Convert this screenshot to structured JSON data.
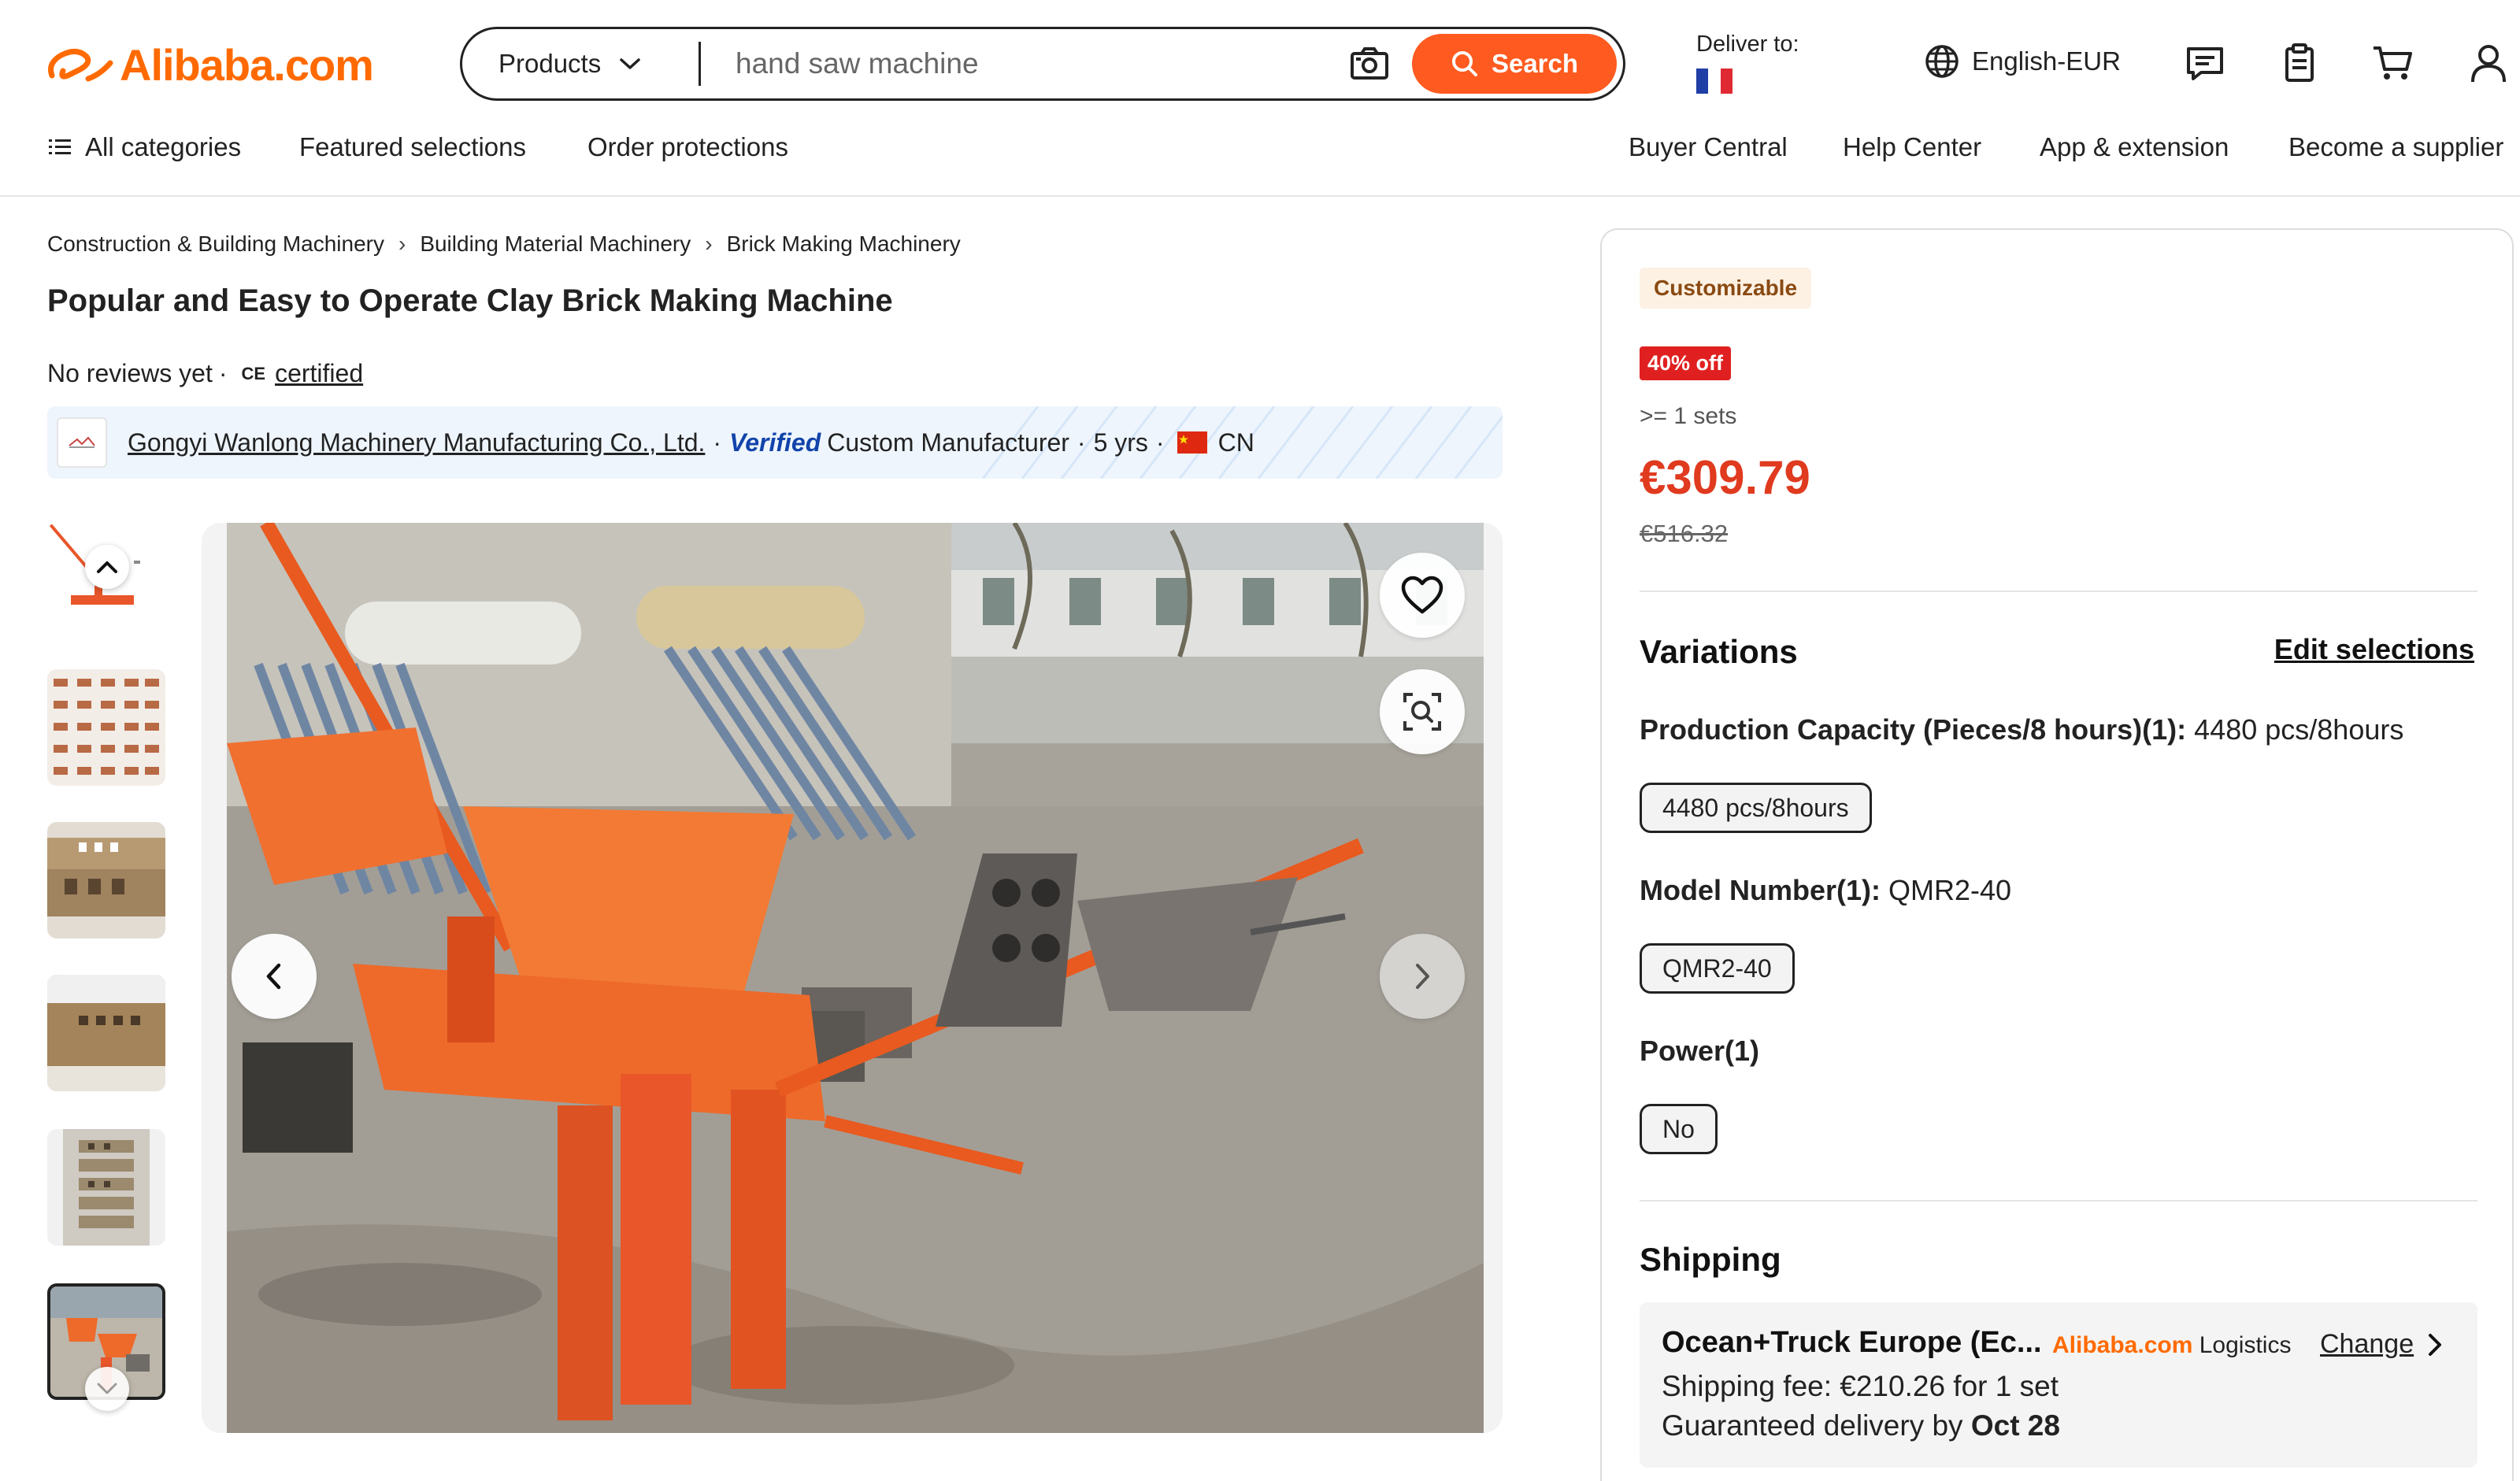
{
  "brand": {
    "logo_text": "Alibaba.com",
    "accent_color": "#ff6a00"
  },
  "search": {
    "category": "Products",
    "placeholder": "hand saw machine",
    "button_label": "Search"
  },
  "header": {
    "deliver_label": "Deliver to:",
    "deliver_country_flag": "FR",
    "language": "English-EUR",
    "icons": [
      "message-icon",
      "orders-icon",
      "cart-icon",
      "account-icon"
    ]
  },
  "subnav": {
    "all_categories": "All categories",
    "featured": "Featured selections",
    "order_protections": "Order protections",
    "buyer_central": "Buyer Central",
    "help_center": "Help Center",
    "app_extension": "App & extension",
    "become_supplier": "Become a supplier"
  },
  "breadcrumb": [
    "Construction & Building Machinery",
    "Building Material Machinery",
    "Brick Making Machinery"
  ],
  "product": {
    "title": "Popular and Easy to Operate Clay Brick Making Machine",
    "reviews": "No reviews yet",
    "separator": "·",
    "ce_mark": "CE",
    "certified": "certified"
  },
  "supplier": {
    "name": "Gongyi Wanlong Machinery Manufacturing Co., Ltd.",
    "sep": "·",
    "verified": "Verified",
    "type": "Custom Manufacturer",
    "years": "5 yrs",
    "country": "CN"
  },
  "thumbnails": {
    "count": 6,
    "active_index": 5
  },
  "offer": {
    "badge_customizable": "Customizable",
    "badge_discount": "40% off",
    "min_order": ">= 1 sets",
    "price": "€309.79",
    "old_price": "€516.32"
  },
  "variations": {
    "title": "Variations",
    "edit_label": "Edit selections",
    "capacity_label": "Production Capacity (Pieces/8 hours)(1):",
    "capacity_value": "4480 pcs/8hours",
    "capacity_option": "4480 pcs/8hours",
    "model_label": "Model Number(1):",
    "model_value": "QMR2-40",
    "model_option": "QMR2-40",
    "power_label": "Power(1)",
    "power_option": "No"
  },
  "shipping": {
    "title": "Shipping",
    "method": "Ocean+Truck Europe (Ec...",
    "logistics_brand": "Alibaba.com",
    "logistics_word": "Logistics",
    "change_label": "Change",
    "fee": "Shipping fee: €210.26 for 1 set",
    "delivery_prefix": "Guaranteed delivery by",
    "delivery_date": "Oct 28"
  }
}
